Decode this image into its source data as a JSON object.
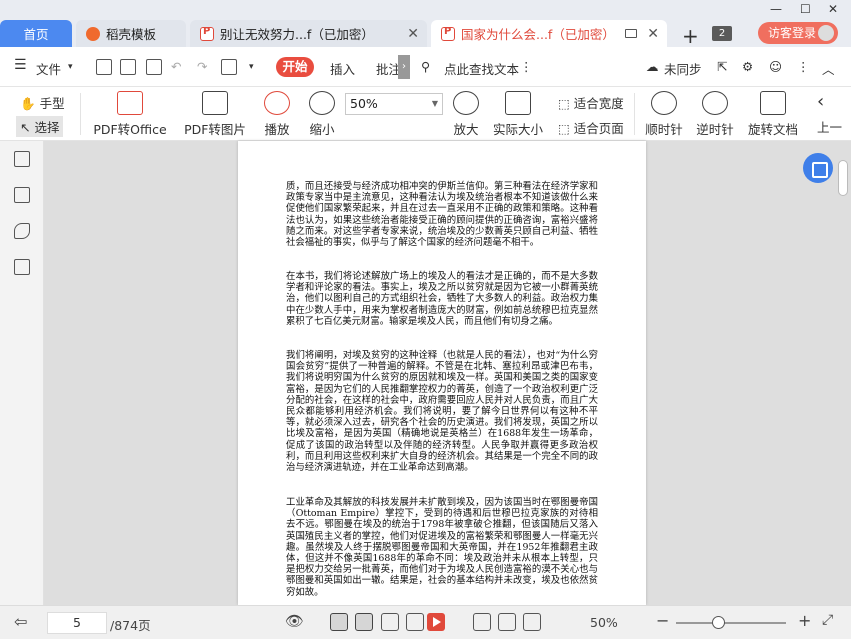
{
  "tabs": {
    "home": "首页",
    "doc1": "稻壳模板",
    "doc2": "别让无效努力...f（已加密）",
    "doc3": "国家为什么会...f（已加密）"
  },
  "window": {
    "badge": "2",
    "login": "访客登录"
  },
  "menu": {
    "file": "文件",
    "start": "开始",
    "insert": "插入",
    "annotate": "批注",
    "search": "点此查找文本",
    "sync": "未同步"
  },
  "ribbon": {
    "hand": "手型",
    "select": "选择",
    "pdf_to_office": "PDF转Office",
    "pdf_to_image": "PDF转图片",
    "play": "播放",
    "zoom_out": "缩小",
    "zoom_value": "50%",
    "zoom_in": "放大",
    "actual_size": "实际大小",
    "fit_width": "适合宽度",
    "fit_page": "适合页面",
    "rotate_cw": "顺时针",
    "rotate_ccw": "逆时针",
    "rotate_doc": "旋转文档",
    "prev": "上一"
  },
  "document": {
    "paragraphs": [
      "质，而且还接受与经济成功相冲突的伊斯兰信仰。第三种看法在经济学家和政策专家当中是主流意见，这种看法认为埃及统治者根本不知道该做什么来促使他们国家繁荣起来，并且在过去一直采用不正确的政策和策略。这种看法也认为，如果这些统治者能接受正确的顾问提供的正确咨询，富裕兴盛将随之而来。对这些学者专家来说，统治埃及的少数菁英只顾自己利益、牺牲社会福祉的事实，似乎与了解这个国家的经济问题毫不相干。",
      "在本书，我们将论述解放广场上的埃及人的看法才是正确的，而不是大多数学者和评论家的看法。事实上，埃及之所以贫穷就是因为它被一小群菁英统治，他们以图利自己的方式组织社会，牺牲了大多数人的利益。政治权力集中在少数人手中，用来为掌权者制造庞大的财富，例如前总统穆巴拉克显然累积了七百亿美元财富。输家是埃及人民，而且他们有切身之痛。",
      "我们将阐明，对埃及贫穷的这种诠释（也就是人民的看法），也对“为什么穷国会贫穷”提供了一种普遍的解释。不管是在北韩、塞拉利昂或津巴布韦，我们将说明穷国为什么贫穷的原因就和埃及一样。英国和美国之类的国家变富裕，是因为它们的人民推翻掌控权力的菁英，创造了一个政治权利更广泛分配的社会，在这样的社会中，政府需要回应人民并对人民负责，而且广大民众都能够利用经济机会。我们将说明，要了解今日世界何以有这种不平等，就必须深入过去，研究各个社会的历史演进。我们将发现，英国之所以比埃及富裕，是因为英国（精确地说是英格兰）在1688年发生一场革命，促成了该国的政治转型以及伴随的经济转型。人民争取并赢得更多政治权利，而且利用这些权利来扩大自身的经济机会。其结果是一个完全不同的政治与经济演进轨迹，并在工业革命达到高潮。",
      "工业革命及其解放的科技发展并未扩散到埃及，因为该国当时在鄂图曼帝国（Ottoman Empire）掌控下，受到的待遇和后世穆巴拉克家族的对待相去不远。鄂图曼在埃及的统治于1798年被拿破仑推翻，但该国随后又落入英国殖民主义者的掌控，他们对促进埃及的富裕繁荣和鄂图曼人一样毫无兴趣。虽然埃及人终于摆脱鄂图曼帝国和大英帝国，并在1952年推翻君主政体，但这并不像英国1688年的革命不同：埃及政治并未从根本上转型，只是把权力交给另一批菁英，而他们对于为埃及人民创造富裕的漠不关心也与鄂图曼和英国如出一辙。结果是，社会的基本结构并未改变，埃及也依然贫穷如故。"
    ]
  },
  "status": {
    "page": "5",
    "total": "/874页",
    "zoom": "50%"
  }
}
